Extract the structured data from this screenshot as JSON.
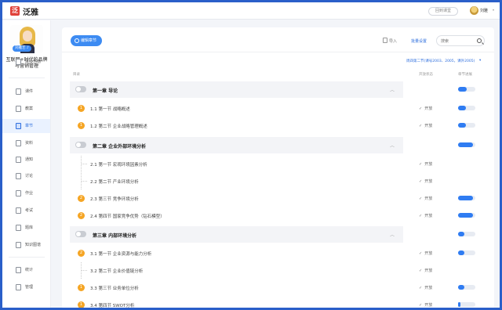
{
  "app": {
    "logo_letter": "泛",
    "name": "泛雅",
    "back_button": "回到课堂",
    "user": "刘雅",
    "user_caret": "▾"
  },
  "sidebar": {
    "cover_tag": "刘雅艺 ♪",
    "course_title": "互联网+时代的品牌与营销管理",
    "items": [
      {
        "label": "班级活动"
      },
      {
        "label": "课件"
      },
      {
        "label": "教案"
      },
      {
        "label": "章节",
        "active": true
      },
      {
        "label": "资料"
      },
      {
        "label": "通知"
      },
      {
        "label": "讨论"
      },
      {
        "label": "作业"
      },
      {
        "label": "考试"
      },
      {
        "label": "题库"
      },
      {
        "label": "知识图谱"
      },
      {
        "label": "统计"
      },
      {
        "label": "管理"
      }
    ]
  },
  "toolbar": {
    "edit_label": "编辑章节",
    "import_label": "导入",
    "batch_label": "批量设置",
    "search_placeholder": "搜索"
  },
  "filter": {
    "label": "周四第二节(课号2003、2005，课外2005)",
    "caret": "▾"
  },
  "columns": {
    "catalog": "目录",
    "status": "开放状态",
    "progress": "章节进展"
  },
  "rows": [
    {
      "type": "chapter",
      "title": "第一章 导论",
      "progress": 0.5,
      "caret": "︿"
    },
    {
      "type": "section",
      "title": "1.1 第一节 战略概述",
      "badge": "1",
      "status": "开放",
      "progress": 0.45
    },
    {
      "type": "section",
      "title": "1.2 第二节 企业战略管理概述",
      "badge": "1",
      "status": "开放",
      "progress": 0.45
    },
    {
      "type": "chapter",
      "title": "第二章 企业外部环境分析",
      "progress": 0.85,
      "caret": "︿"
    },
    {
      "type": "sub",
      "title": "2.1 第一节 宏观环境因素分析",
      "status": "开放",
      "progress": null
    },
    {
      "type": "sub",
      "title": "2.2 第二节 产业环境分析",
      "status": "开放",
      "progress": null
    },
    {
      "type": "section",
      "title": "2.3 第三节 竞争环境分析",
      "badge": "2",
      "status": "开放",
      "progress": 0.85
    },
    {
      "type": "section",
      "title": "2.4 第四节 国家竞争优势（钻石模型）",
      "badge": "2",
      "status": "开放",
      "progress": 0.85
    },
    {
      "type": "chapter",
      "title": "第三章 内部环境分析",
      "progress": 0.35,
      "caret": "︿"
    },
    {
      "type": "section",
      "title": "3.1 第一节 企业资源与能力分析",
      "badge": "2",
      "status": "开放",
      "progress": 0.35
    },
    {
      "type": "sub",
      "title": "3.2 第二节 企业价值链分析",
      "status": "开放",
      "progress": null
    },
    {
      "type": "section",
      "title": "3.3 第三节 业务单位分析",
      "badge": "1",
      "status": "开放",
      "progress": 0.35
    },
    {
      "type": "section",
      "title": "3.4 第四节 SWOT分析",
      "badge": "1",
      "status": "开放",
      "progress": 0.15
    }
  ],
  "status_check": "✓"
}
